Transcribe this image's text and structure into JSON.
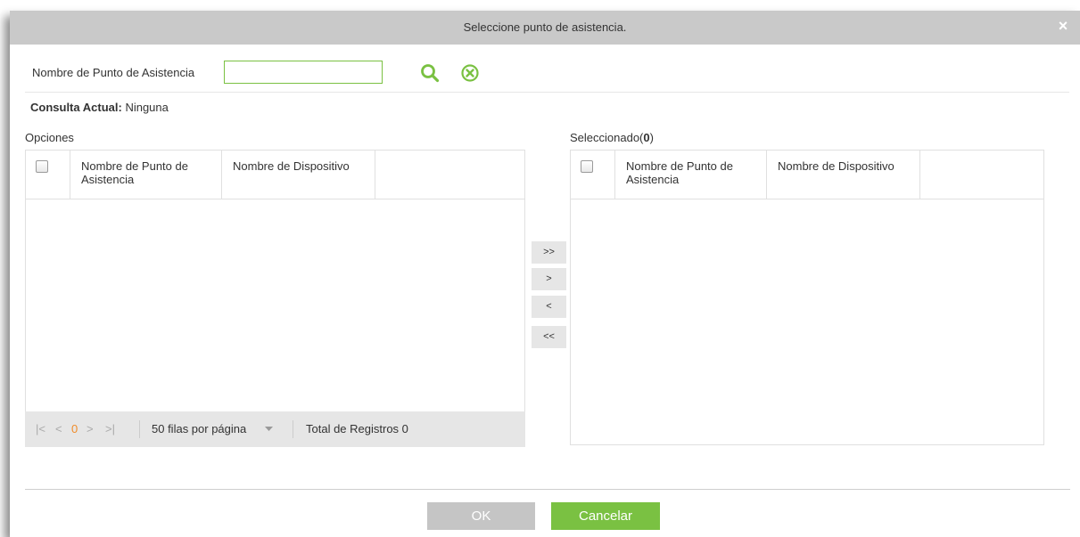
{
  "dialog": {
    "title": "Seleccione punto de asistencia.",
    "close_glyph": "×"
  },
  "search": {
    "label": "Nombre de Punto de Asistencia",
    "value": "",
    "placeholder": "",
    "search_icon": "search-icon",
    "clear_icon": "clear-circle-icon"
  },
  "query": {
    "label": "Consulta Actual:",
    "value": "Ninguna"
  },
  "options": {
    "label": "Opciones",
    "columns": [
      "Nombre de Punto de Asistencia",
      "Nombre de Dispositivo"
    ],
    "rows": []
  },
  "pager": {
    "first": "|<",
    "prev": "<",
    "page": "0",
    "next": ">",
    "last": ">|",
    "rows_per_page": "50 filas por página",
    "total": "Total de Registros 0"
  },
  "move_buttons": {
    "all_right": ">>",
    "right": ">",
    "left": "<",
    "all_left": "<<"
  },
  "selected": {
    "label_prefix": "Seleccionado(",
    "count": "0",
    "label_suffix": ")",
    "columns": [
      "Nombre de Punto de Asistencia",
      "Nombre de Dispositivo"
    ],
    "rows": []
  },
  "footer": {
    "ok": "OK",
    "cancel": "Cancelar"
  },
  "colors": {
    "accent": "#7ac142",
    "titlebar": "#c9c9c9",
    "pager_page": "#f08c2a"
  }
}
